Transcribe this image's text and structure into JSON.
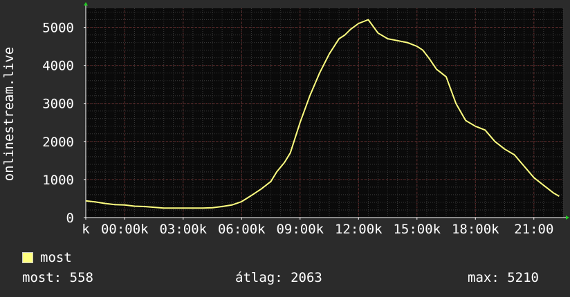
{
  "chart_data": {
    "type": "line",
    "ylabel": "onlinestream.live",
    "ylim": [
      0,
      5500
    ],
    "yticks": [
      0,
      1000,
      2000,
      3000,
      4000,
      5000
    ],
    "xlim": [
      -2,
      22.5
    ],
    "xticks": [
      {
        "x": -2,
        "label": "k"
      },
      {
        "x": 0,
        "label": "00:00k"
      },
      {
        "x": 3,
        "label": "03:00k"
      },
      {
        "x": 6,
        "label": "06:00k"
      },
      {
        "x": 9,
        "label": "09:00k"
      },
      {
        "x": 12,
        "label": "12:00k"
      },
      {
        "x": 15,
        "label": "15:00k"
      },
      {
        "x": 18,
        "label": "18:00k"
      },
      {
        "x": 21,
        "label": "21:00"
      }
    ],
    "grid": true,
    "series": [
      {
        "name": "most",
        "color": "#ffff80",
        "x": [
          -2,
          -1.5,
          -1,
          -0.5,
          0,
          0.5,
          1,
          1.5,
          2,
          2.5,
          3,
          3.5,
          4,
          4.5,
          5,
          5.5,
          6,
          6.5,
          7,
          7.5,
          7.8,
          8.2,
          8.5,
          9,
          9.5,
          10,
          10.5,
          11,
          11.3,
          11.6,
          12,
          12.5,
          13,
          13.5,
          14,
          14.5,
          15,
          15.3,
          15.6,
          16,
          16.5,
          17,
          17.5,
          18,
          18.5,
          19,
          19.5,
          20,
          20.5,
          21,
          21.5,
          22,
          22.3
        ],
        "values": [
          440,
          410,
          370,
          340,
          330,
          300,
          290,
          270,
          250,
          250,
          250,
          250,
          250,
          260,
          290,
          330,
          420,
          580,
          750,
          950,
          1200,
          1450,
          1700,
          2500,
          3200,
          3800,
          4300,
          4700,
          4800,
          4950,
          5100,
          5200,
          4850,
          4700,
          4650,
          4600,
          4500,
          4400,
          4200,
          3900,
          3700,
          3000,
          2550,
          2400,
          2300,
          2000,
          1800,
          1650,
          1350,
          1050,
          850,
          650,
          560
        ]
      }
    ]
  },
  "legend": {
    "label": "most",
    "swatch_color": "#ffff80"
  },
  "stats": {
    "now": "most: 558",
    "avg": "átlag: 2063",
    "max": "max: 5210"
  }
}
